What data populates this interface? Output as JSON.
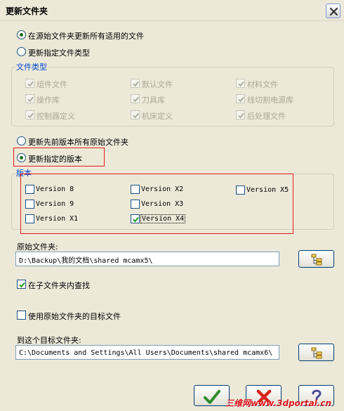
{
  "window": {
    "title": "更新文件夹"
  },
  "options": {
    "update_all": "在源始文件夹更新所有适用的文件",
    "update_specified": "更新指定文件类型"
  },
  "file_types": {
    "title": "文件类型",
    "items": [
      "组件文件",
      "默认文件",
      "材料文件",
      "操作库",
      "刀具库",
      "线切割电源库",
      "控制器定义",
      "机床定义",
      "后处理文件"
    ]
  },
  "version_options": {
    "update_previous": "更新先前版本所有原始文件夹",
    "update_specified_version": "更新指定的版本"
  },
  "versions": {
    "title": "版本",
    "items": [
      {
        "label": "Version 8",
        "checked": false
      },
      {
        "label": "Version X2",
        "checked": false
      },
      {
        "label": "Version X5",
        "checked": false
      },
      {
        "label": "Version 9",
        "checked": false
      },
      {
        "label": "Version X3",
        "checked": false
      },
      {
        "label": "Version X1",
        "checked": false
      },
      {
        "label": "Version X4",
        "checked": true
      }
    ]
  },
  "source": {
    "label": "原始文件夹:",
    "path": "D:\\Backup\\我的文档\\shared mcamx5\\",
    "search_subfolders": "在子文件夹内查找"
  },
  "target": {
    "use_source_target": "使用原始文件夹的目标文件",
    "label": "到这个目标文件夹:",
    "path": "C:\\Documents and Settings\\All Users\\Documents\\shared mcamx6\\"
  },
  "watermark": "三维网www.3dportal.cn",
  "colors": {
    "accent": "#0046D5",
    "highlight": "#E41C1C",
    "ok": "#2E8B2E",
    "cancel": "#D8241B",
    "help": "#4A4A9A"
  }
}
